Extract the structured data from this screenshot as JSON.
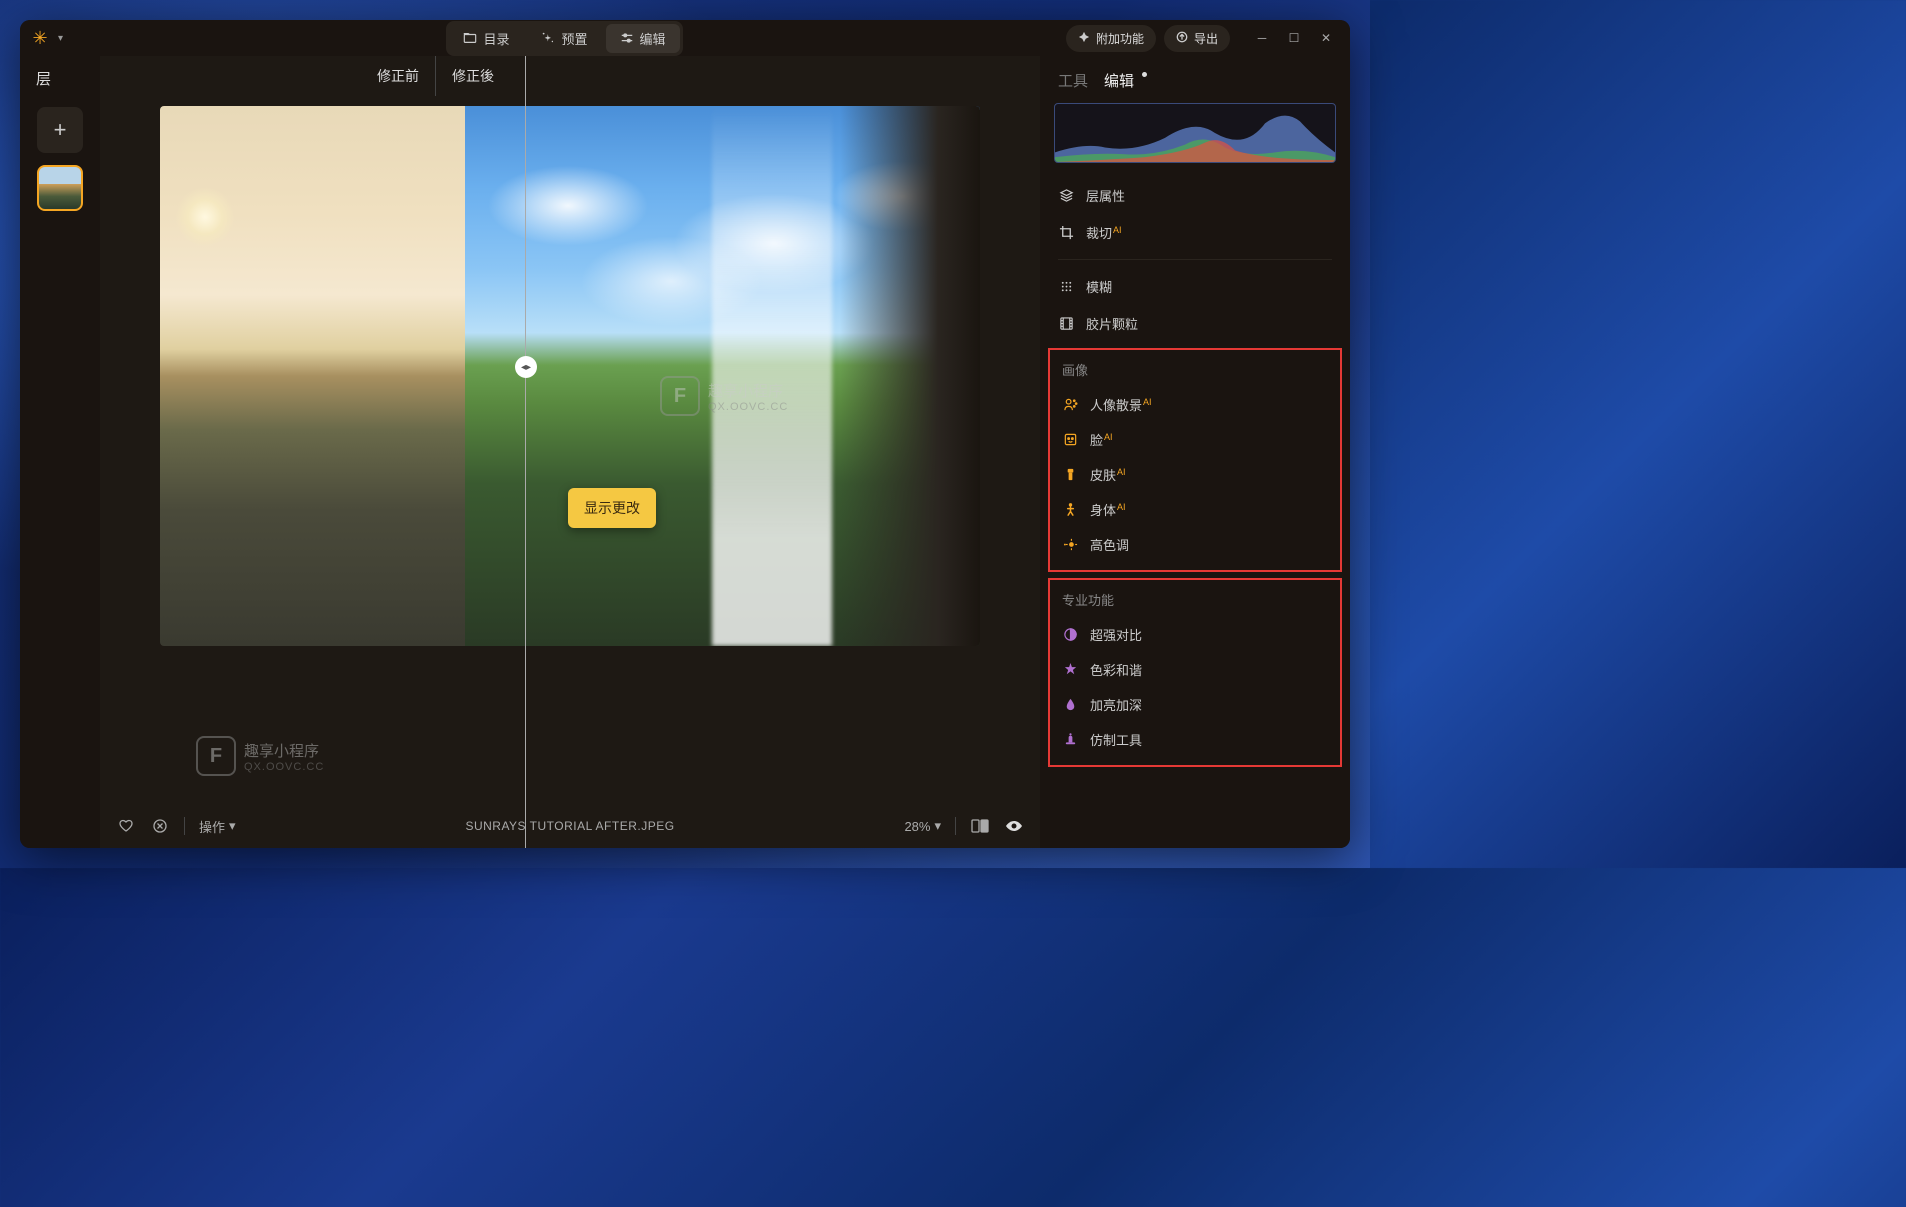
{
  "titlebar": {
    "tabs": {
      "catalog": "目录",
      "presets": "预置",
      "edit": "编辑"
    },
    "extras_btn": "附加功能",
    "export_btn": "导出"
  },
  "left_panel": {
    "layers_label": "层"
  },
  "center": {
    "before_label": "修正前",
    "after_label": "修正後",
    "tooltip": "显示更改",
    "filename": "SUNRAYS TUTORIAL AFTER.JPEG",
    "ops_label": "操作",
    "zoom": "28%"
  },
  "watermark": {
    "title": "趣享小程序",
    "sub": "QX.OOVC.CC"
  },
  "right_panel": {
    "tabs": {
      "tools": "工具",
      "edit": "编辑"
    },
    "basic_tools": [
      {
        "icon": "layers",
        "label": "层属性"
      },
      {
        "icon": "crop",
        "label": "裁切",
        "ai": true
      }
    ],
    "effect_tools": [
      {
        "icon": "blur",
        "label": "模糊"
      },
      {
        "icon": "film",
        "label": "胶片颗粒"
      }
    ],
    "sections": [
      {
        "title": "画像",
        "items": [
          {
            "icon": "portrait",
            "label": "人像散景",
            "ai": true,
            "color": "#f5a623"
          },
          {
            "icon": "face",
            "label": "脸",
            "ai": true,
            "color": "#f5a623"
          },
          {
            "icon": "skin",
            "label": "皮肤",
            "ai": true,
            "color": "#f5a623"
          },
          {
            "icon": "body",
            "label": "身体",
            "ai": true,
            "color": "#f5a623"
          },
          {
            "icon": "highkey",
            "label": "高色调",
            "color": "#f5a623"
          }
        ]
      },
      {
        "title": "专业功能",
        "items": [
          {
            "icon": "contrast",
            "label": "超强对比",
            "color": "#b070d0"
          },
          {
            "icon": "harmony",
            "label": "色彩和谐",
            "color": "#b070d0"
          },
          {
            "icon": "dodge",
            "label": "加亮加深",
            "color": "#b070d0"
          },
          {
            "icon": "clone",
            "label": "仿制工具",
            "color": "#b070d0"
          }
        ]
      }
    ]
  }
}
